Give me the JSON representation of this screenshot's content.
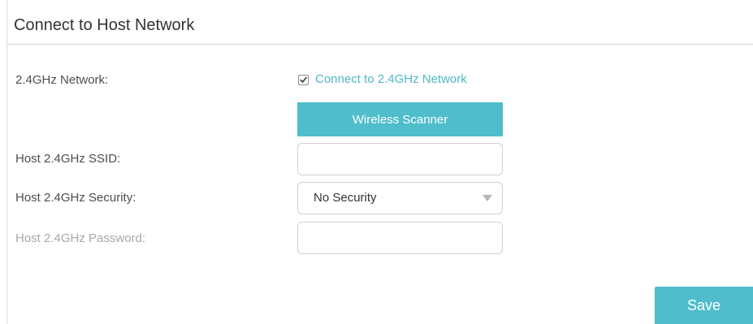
{
  "section": {
    "title": "Connect to Host Network"
  },
  "network": {
    "label": "2.4GHz Network:",
    "checkbox_label": "Connect to 2.4GHz Network",
    "checkbox_checked": true
  },
  "scanner": {
    "button_label": "Wireless Scanner"
  },
  "ssid": {
    "label": "Host 2.4GHz SSID:",
    "value": ""
  },
  "security": {
    "label": "Host 2.4GHz Security:",
    "selected": "No Security"
  },
  "password": {
    "label": "Host 2.4GHz Password:",
    "value": "",
    "disabled": true
  },
  "footer": {
    "save_label": "Save"
  },
  "colors": {
    "accent": "#4fbdcb",
    "accent_text": "#4fb8c8",
    "label_text": "#4d4d4d",
    "disabled_text": "#a8a8a8"
  },
  "icons": {
    "checkbox": "checkmark-icon",
    "dropdown": "triangle-down-icon"
  }
}
